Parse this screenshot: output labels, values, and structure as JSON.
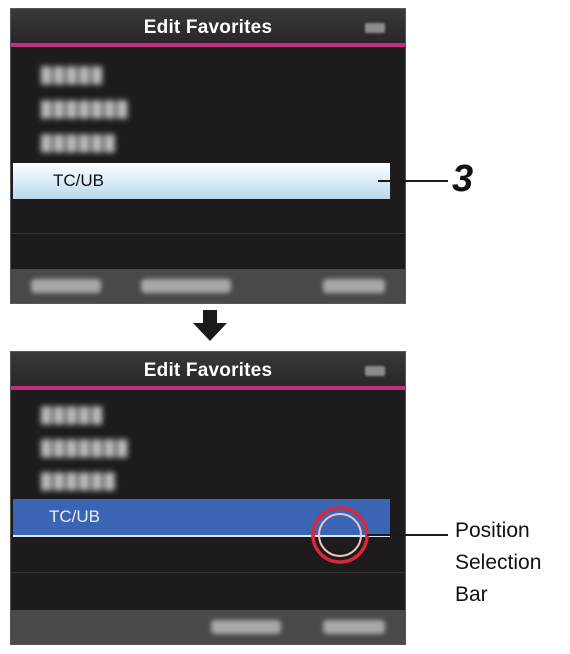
{
  "screens": [
    {
      "title": "Edit Favorites",
      "selected_item": "TC/UB",
      "selection_style": "selected"
    },
    {
      "title": "Edit Favorites",
      "selected_item": "TC/UB",
      "selection_style": "position-selection"
    }
  ],
  "callouts": {
    "step_number": "3",
    "position_bar_label_line1": "Position",
    "position_bar_label_line2": "Selection",
    "position_bar_label_line3": "Bar"
  },
  "colors": {
    "title_accent": "#c2307d",
    "screen_background": "#1d1b1c",
    "highlight_selected": "#cfe5f4",
    "highlight_position_bar": "#3a65b4",
    "callout_circle": "#d9283a"
  },
  "icons": {
    "transition_arrow": "down-arrow-icon"
  }
}
